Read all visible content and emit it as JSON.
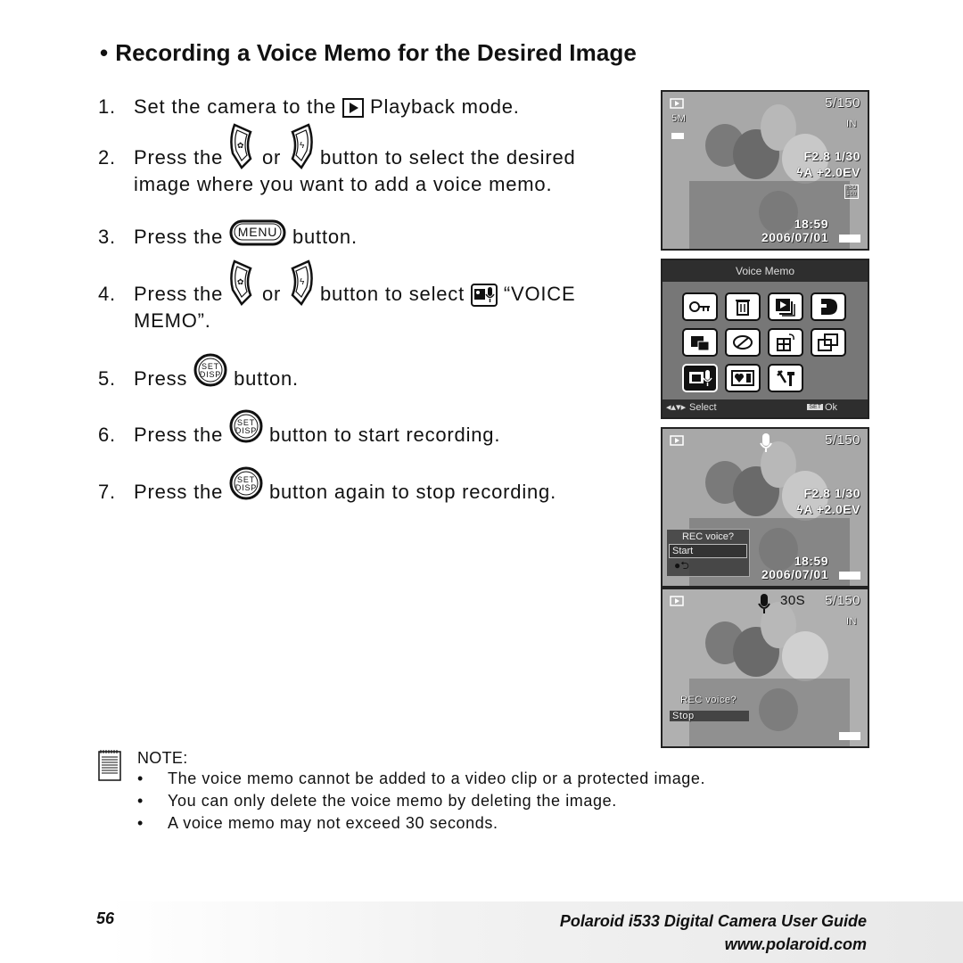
{
  "page": {
    "title": "Recording a Voice Memo for the Desired Image",
    "title_bullet": "•"
  },
  "steps": [
    {
      "num": "1.",
      "parts": [
        "Set the camera to the",
        "Playback mode."
      ]
    },
    {
      "num": "2.",
      "parts": [
        "Press the",
        "or",
        "button to select the desired"
      ],
      "cont": "image where you want to add a voice memo."
    },
    {
      "num": "3.",
      "parts": [
        "Press the",
        "button."
      ]
    },
    {
      "num": "4.",
      "parts": [
        "Press the",
        "or",
        "button to select",
        "“VOICE"
      ],
      "cont": "MEMO”."
    },
    {
      "num": "5.",
      "parts": [
        "Press",
        "button."
      ]
    },
    {
      "num": "6.",
      "parts": [
        "Press the",
        "button to start recording."
      ]
    },
    {
      "num": "7.",
      "parts": [
        "Press the",
        "button again to stop recording."
      ]
    }
  ],
  "buttons": {
    "menu_label": "MENU",
    "set_label_1": "SET",
    "set_label_2": "DISP"
  },
  "screens": {
    "playback": {
      "counter": "5/150",
      "resolution": "5M",
      "memory": "IN",
      "aperture_shutter": "F2.8  1/30",
      "flash_ev": "ϟA  +2.0EV",
      "iso": "ISO 100",
      "time": "18:59",
      "date": "2006/07/01"
    },
    "menu": {
      "header": "Voice Memo",
      "footer_select": "Select",
      "footer_set": "SET",
      "footer_ok": "Ok",
      "items": [
        "protect-icon",
        "delete-icon",
        "slideshow-icon",
        "dpof-icon",
        "copy-to-card-icon",
        "color-effect-icon",
        "rotate-icon",
        "resize-icon",
        "voice-memo-icon",
        "startup-image-icon",
        "setup-icon"
      ],
      "selected_index": 8
    },
    "rec_start": {
      "counter": "5/150",
      "popup_title": "REC voice?",
      "popup_option": "Start",
      "popup_back": "●⮌",
      "time": "18:59",
      "date": "2006/07/01"
    },
    "rec_stop": {
      "counter": "5/150",
      "remaining": "30S",
      "memory": "IN",
      "popup_title": "REC voice?",
      "popup_option": "Stop"
    }
  },
  "note": {
    "title": "NOTE:",
    "items": [
      "The voice memo cannot be added to a video clip or a protected image.",
      "You can only delete the voice memo by deleting the image.",
      "A voice memo may not exceed 30 seconds."
    ]
  },
  "footer": {
    "page_number": "56",
    "guide_title": "Polaroid i533 Digital Camera User Guide",
    "website": "www.polaroid.com"
  }
}
